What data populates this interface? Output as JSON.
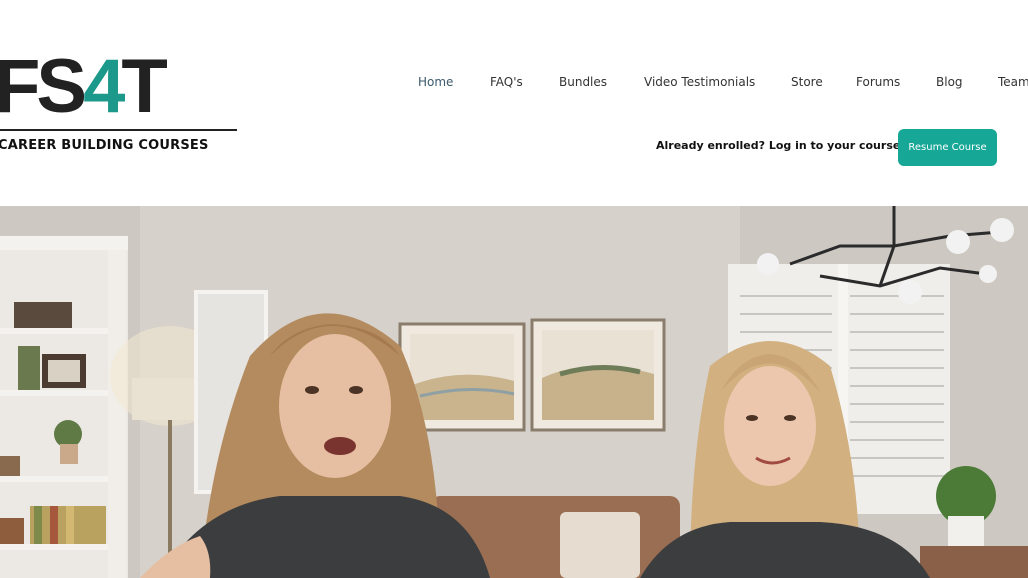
{
  "logo": {
    "mark_letters": "FS",
    "mark_number": "4",
    "mark_tail": "T",
    "tagline": "CAREER BUILDING COURSES"
  },
  "nav": {
    "items": [
      {
        "label": "Home",
        "active": true
      },
      {
        "label": "FAQ's"
      },
      {
        "label": "Bundles"
      },
      {
        "label": "Video Testimonials"
      },
      {
        "label": "Store"
      },
      {
        "label": "Forums"
      },
      {
        "label": "Blog"
      },
      {
        "label": "Team"
      }
    ]
  },
  "enrolled_text": "Already enrolled? Log in to your course",
  "resume_label": "Resume Course",
  "colors": {
    "brand_teal": "#17a796",
    "logo_dark": "#222222"
  }
}
